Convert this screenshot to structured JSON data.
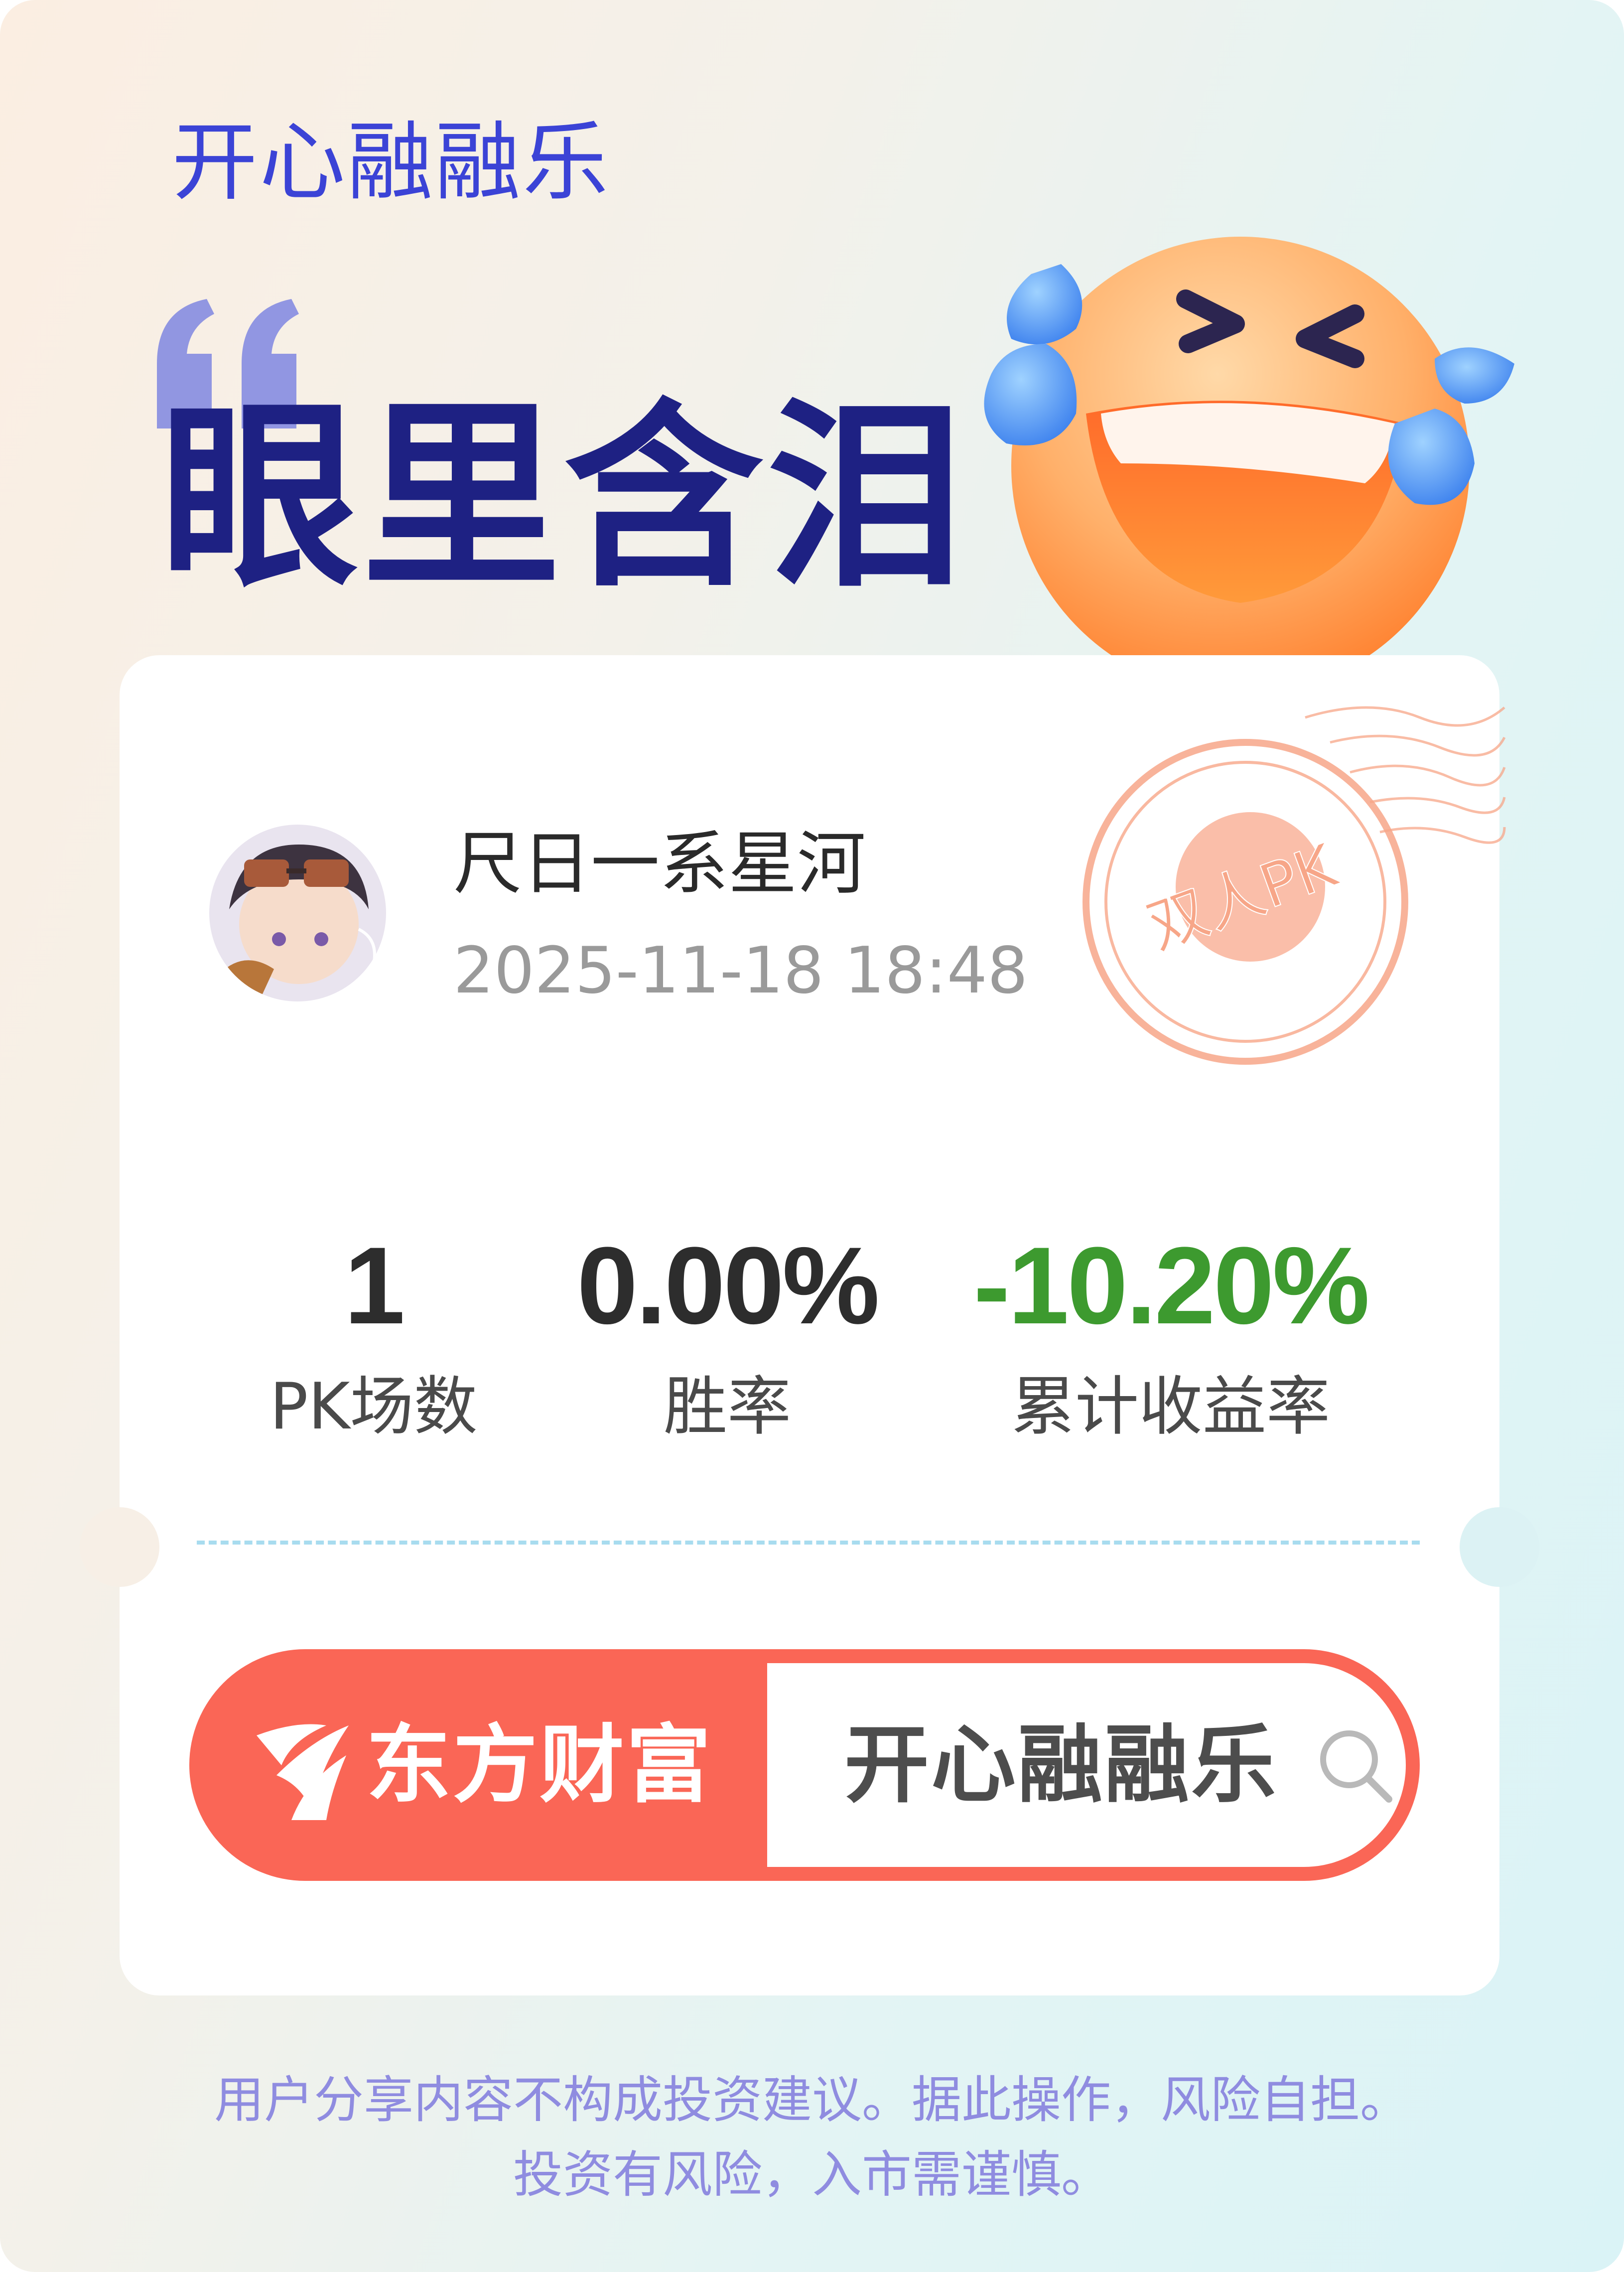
{
  "brand": "开心融融乐",
  "headline": "眼里含泪",
  "stamp_text": "双人PK",
  "user": {
    "name": "尺日一系星河",
    "datetime": "2025-11-18 18:48"
  },
  "stats": [
    {
      "value": "1",
      "label": "PK场数",
      "color": "#2d2d2d"
    },
    {
      "value": "0.00%",
      "label": "胜率",
      "color": "#2d2d2d"
    },
    {
      "value": "-10.20%",
      "label": "累计收益率",
      "color": "#3d9a2f"
    }
  ],
  "search": {
    "app_name": "东方财富",
    "query": "开心融融乐",
    "icon": "search-icon"
  },
  "disclaimer": [
    "用户分享内容不构成投资建议。据此操作，风险自担。",
    "投资有风险，入市需谨慎。"
  ],
  "colors": {
    "brand": "#3b43d6",
    "headline": "#1e2183",
    "accent": "#fa6656",
    "positive_negative": "#3d9a2f",
    "disclaimer": "#8f8ce0"
  }
}
